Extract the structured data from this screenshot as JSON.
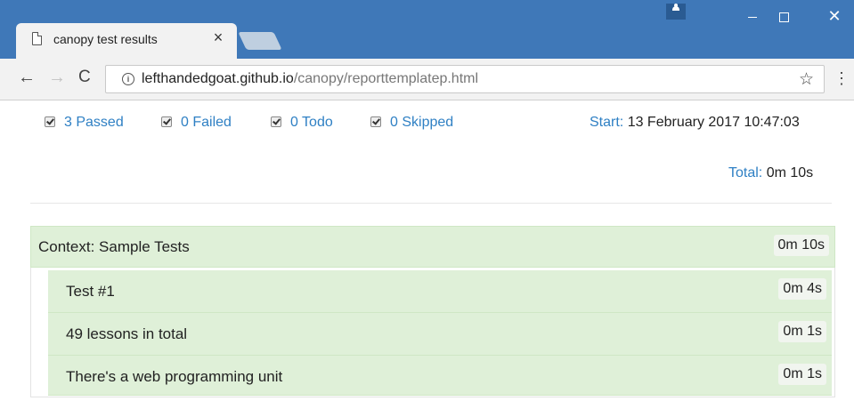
{
  "browser": {
    "tab_title": "canopy test results",
    "tab_close": "×",
    "url_domain": "lefthandedgoat.github.io",
    "url_path": "/canopy/reporttemplatep.html",
    "info_glyph": "i",
    "back_glyph": "←",
    "forward_glyph": "→",
    "reload_glyph": "C",
    "star_glyph": "☆",
    "menu_glyph": "⋮",
    "close_glyph": "✕"
  },
  "filters": [
    {
      "label": "3 Passed",
      "checked": true
    },
    {
      "label": "0 Failed",
      "checked": true
    },
    {
      "label": "0 Todo",
      "checked": true
    },
    {
      "label": "0 Skipped",
      "checked": true
    }
  ],
  "summary": {
    "start_label": "Start:",
    "start_value": "13 February 2017 10:47:03",
    "total_label": "Total:",
    "total_value": "0m 10s"
  },
  "context": {
    "label": "Context: Sample Tests",
    "duration": "0m 10s"
  },
  "tests": [
    {
      "label": "Test #1",
      "duration": "0m 4s"
    },
    {
      "label": "49 lessons in total",
      "duration": "0m 1s"
    },
    {
      "label": "There's a web programming unit",
      "duration": "0m 1s"
    }
  ],
  "colors": {
    "titlebar": "#3f78b8",
    "link": "#2f80c4",
    "pass_background": "#dff0d8"
  }
}
